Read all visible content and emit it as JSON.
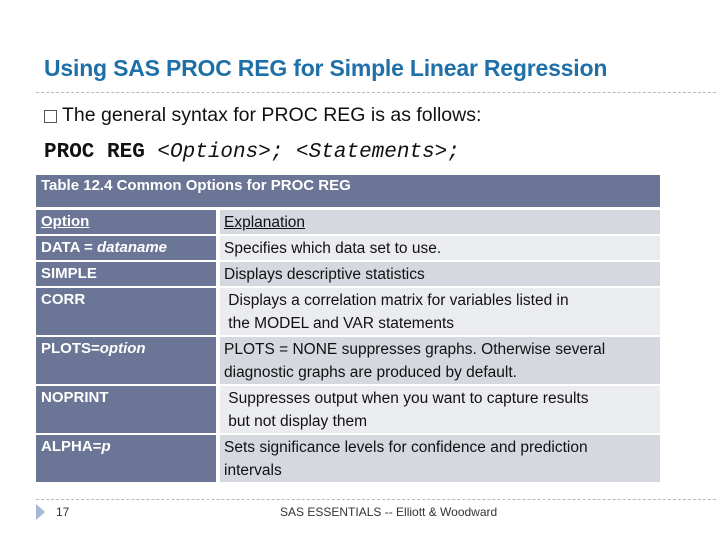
{
  "slide": {
    "title": "Using SAS PROC REG for Simple Linear Regression",
    "bullet": "The general syntax for PROC REG is as follows:",
    "code": {
      "keyword": "PROC REG ",
      "options": "<Options>;",
      "statements": " <Statements>;"
    }
  },
  "table": {
    "caption": "Table 12.4 Common Options for PROC REG",
    "header": {
      "option": "Option",
      "explanation": "Explanation"
    },
    "rows": [
      {
        "option": "DATA = ",
        "option_italic": "dataname",
        "explanation": "Specifies which data set to use."
      },
      {
        "option": "SIMPLE",
        "option_italic": "",
        "explanation": "Displays descriptive statistics"
      },
      {
        "option": "CORR",
        "option_italic": "",
        "explanation": " Displays a correlation matrix for variables listed in",
        "explanation2": " the MODEL and VAR statements"
      },
      {
        "option": "PLOTS=",
        "option_italic": "option",
        "explanation": "PLOTS = NONE suppresses graphs. Otherwise several",
        "explanation2": "diagnostic graphs are produced by default."
      },
      {
        "option": "NOPRINT",
        "option_italic": "",
        "explanation": " Suppresses output when you want to capture results",
        "explanation2": " but not display them"
      },
      {
        "option": "ALPHA=",
        "option_italic": "p",
        "explanation": "Sets significance levels for confidence and prediction",
        "explanation2": "intervals"
      }
    ]
  },
  "footer": {
    "page_number": "17",
    "text": "SAS ESSENTIALS -- Elliott & Woodward"
  },
  "colors": {
    "title": "#1F6FA8",
    "table_header": "#6B7596",
    "row_dark": "#D6D8E0",
    "row_light": "#EBECF0"
  }
}
